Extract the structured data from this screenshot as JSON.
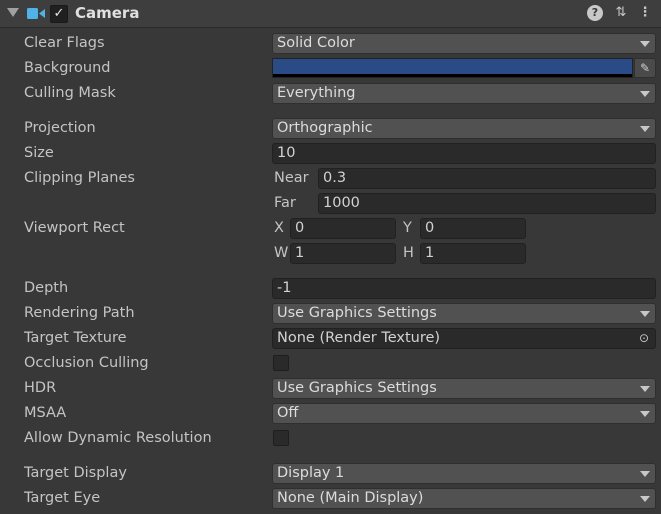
{
  "header": {
    "title": "Camera",
    "enabled": true,
    "check_glyph": "✓",
    "icons": [
      "camera-icon",
      "help-icon",
      "presets-icon",
      "more-icon"
    ],
    "help_glyph": "?",
    "presets_glyph": "⇅",
    "more_glyph": "⋮"
  },
  "properties": {
    "clear_flags": {
      "label": "Clear Flags",
      "value": "Solid Color"
    },
    "background": {
      "label": "Background",
      "color": "#2b4b86",
      "picker_glyph": "✎"
    },
    "culling_mask": {
      "label": "Culling Mask",
      "value": "Everything"
    },
    "projection": {
      "label": "Projection",
      "value": "Orthographic"
    },
    "size": {
      "label": "Size",
      "value": "10"
    },
    "clipping_planes": {
      "label": "Clipping Planes",
      "near_label": "Near",
      "near": "0.3",
      "far_label": "Far",
      "far": "1000"
    },
    "viewport_rect": {
      "label": "Viewport Rect",
      "x_label": "X",
      "x": "0",
      "y_label": "Y",
      "y": "0",
      "w_label": "W",
      "w": "1",
      "h_label": "H",
      "h": "1"
    },
    "depth": {
      "label": "Depth",
      "value": "-1"
    },
    "rendering_path": {
      "label": "Rendering Path",
      "value": "Use Graphics Settings"
    },
    "target_texture": {
      "label": "Target Texture",
      "value": "None (Render Texture)",
      "picker_glyph": "⊙"
    },
    "occlusion_culling": {
      "label": "Occlusion Culling",
      "checked": false
    },
    "hdr": {
      "label": "HDR",
      "value": "Use Graphics Settings"
    },
    "msaa": {
      "label": "MSAA",
      "value": "Off"
    },
    "allow_dynamic_resolution": {
      "label": "Allow Dynamic Resolution",
      "checked": false
    },
    "target_display": {
      "label": "Target Display",
      "value": "Display 1"
    },
    "target_eye": {
      "label": "Target Eye",
      "value": "None (Main Display)"
    }
  }
}
